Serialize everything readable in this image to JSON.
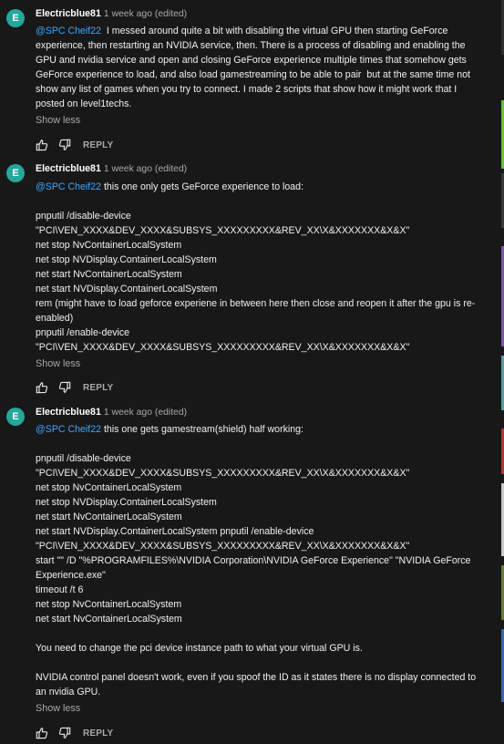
{
  "comments": [
    {
      "avatar_letter": "E",
      "author": "Electricblue81",
      "time": "1 week ago (edited)",
      "mention": "@SPC Cheif22",
      "text": "  I messed around quite a bit with disabling the virtual GPU then starting GeForce experience, then restarting an NVIDIA service, then. There is a process of disabling and enabling the GPU and nvidia service and open and closing GeForce experience multiple times that somehow gets GeForce experience to load, and also load gamestreaming to be able to pair  but at the same time not show any list of games when you try to connect. I made 2 scripts that show how it might work that I posted on level1techs.",
      "show_less": "Show less",
      "reply": "REPLY"
    },
    {
      "avatar_letter": "E",
      "author": "Electricblue81",
      "time": "1 week ago (edited)",
      "mention": "@SPC Cheif22",
      "text": " this one only gets GeForce experience to load:\n\npnputil /disable-device\n\"PCI\\VEN_XXXX&DEV_XXXX&SUBSYS_XXXXXXXXX&REV_XX\\X&XXXXXXX&X&X\"\nnet stop NvContainerLocalSystem\nnet stop NVDisplay.ContainerLocalSystem\nnet start NvContainerLocalSystem\nnet start NVDisplay.ContainerLocalSystem\nrem (might have to load geforce experiene in between here then close and reopen it after the gpu is re-enabled)\npnputil /enable-device\n\"PCI\\VEN_XXXX&DEV_XXXX&SUBSYS_XXXXXXXXX&REV_XX\\X&XXXXXXX&X&X\"",
      "show_less": "Show less",
      "reply": "REPLY"
    },
    {
      "avatar_letter": "E",
      "author": "Electricblue81",
      "time": "1 week ago (edited)",
      "mention": "@SPC Cheif22",
      "text": " this one gets gamestream(shield) half working:\n\npnputil /disable-device\n\"PCI\\VEN_XXXX&DEV_XXXX&SUBSYS_XXXXXXXXX&REV_XX\\X&XXXXXXX&X&X\"\nnet stop NvContainerLocalSystem\nnet stop NVDisplay.ContainerLocalSystem\nnet start NvContainerLocalSystem\nnet start NVDisplay.ContainerLocalSystem pnputil /enable-device\n\"PCI\\VEN_XXXX&DEV_XXXX&SUBSYS_XXXXXXXXX&REV_XX\\X&XXXXXXX&X&X\"\nstart \"\" /D \"%PROGRAMFILES%\\NVIDIA Corporation\\NVIDIA GeForce Experience\" \"NVIDIA GeForce Experience.exe\"\ntimeout /t 6\nnet stop NvContainerLocalSystem\nnet start NvContainerLocalSystem\n\nYou need to change the pci device instance path to what your virtual GPU is.\n\nNVIDIA control panel doesn't work, even if you spoof the ID as it states there is no display connected to an nvidia GPU.",
      "show_less": "Show less",
      "reply": "REPLY"
    }
  ],
  "colors": {
    "background": "#181818",
    "avatar": "#23a89b",
    "mention": "#3ea6ff",
    "muted": "#aaaaaa"
  }
}
